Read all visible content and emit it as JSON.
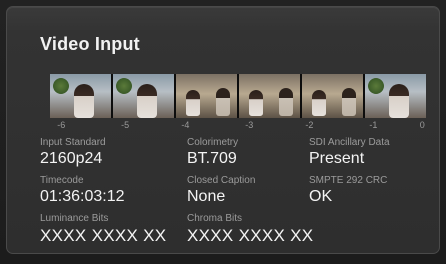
{
  "panel": {
    "title": "Video Input"
  },
  "filmstrip": {
    "ticks": [
      "-6",
      "-5",
      "-4",
      "-3",
      "-2",
      "-1",
      "0"
    ]
  },
  "fields": {
    "input_standard": {
      "label": "Input Standard",
      "value": "2160p24"
    },
    "colorimetry": {
      "label": "Colorimetry",
      "value": "BT.709"
    },
    "sdi_ancillary": {
      "label": "SDI Ancillary Data",
      "value": "Present"
    },
    "timecode": {
      "label": "Timecode",
      "value": "01:36:03:12"
    },
    "closed_caption": {
      "label": "Closed Caption",
      "value": "None"
    },
    "smpte_crc": {
      "label": "SMPTE 292 CRC",
      "value": "OK"
    },
    "luminance_bits": {
      "label": "Luminance Bits",
      "value": "XXXX XXXX XX"
    },
    "chroma_bits": {
      "label": "Chroma Bits",
      "value": "XXXX XXXX XX"
    }
  }
}
